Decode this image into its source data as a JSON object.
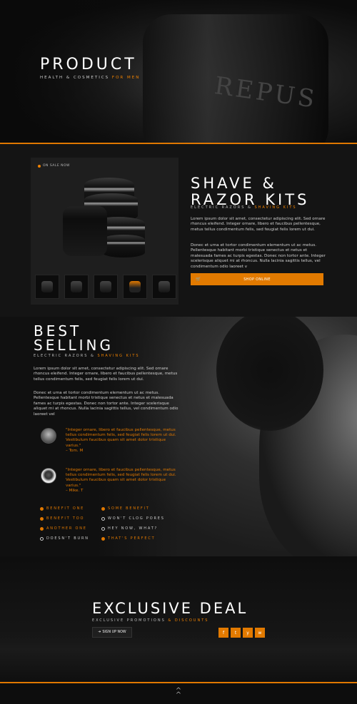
{
  "hero": {
    "title": "PRODUCT",
    "sub_prefix": "HEALTH & COSMETICS ",
    "sub_accent": "FOR MEN",
    "bg_text": "REPUS"
  },
  "product": {
    "sale_badge": "ON SALE NOW",
    "title_line1": "SHAVE &",
    "title_line2": "RAZOR KITS",
    "sub_prefix": "ELECTRIC RAZORS & ",
    "sub_accent": "SHAVING KITS",
    "p1": "Lorem ipsum dolor sit amet, consectetur adipiscing elit. Sed ornare rhoncus eleifend. Integer ornare, libero et faucibus pellentesque, metus tellus condimentum felis, sed feugiat felis lorem ut dui.",
    "p2": "Donec et urna et tortor condimentum elementum ut ac metus. Pellentesque habitant morbi tristique senectus et netus et malesuada fames ac turpis egestas. Donec non tortor ante. Integer scelerisque aliquet mi at rhoncus. Nulla lacinia sagittis tellus, vel condimentum odio laoreet v",
    "shop_label": "SHOP ONLINE"
  },
  "best": {
    "title_line1": "BEST",
    "title_line2": "SELLING",
    "sub_prefix": "ELECTRIC RAZORS & ",
    "sub_accent": "SHAVING KITS",
    "p1": "Lorem ipsum dolor sit amet, consectetur adipiscing elit. Sed ornare rhoncus eleifend. Integer ornare, libero et faucibus pellentesque, metus tellus condimentum felis, sed feugiat felis lorem ut dui.",
    "p2": "Donec et urna et tortor condimentum elementum ut ac metus. Pellentesque habitant morbi tristique senectus et netus et malesuada fames ac turpis egestas. Donec non tortor ante. Integer scelerisque aliquet mi at rhoncus. Nulla lacinia sagittis tellus, vel condimentum odio laoreet vel",
    "testimonials": [
      {
        "quote": "\"Integer ornare, libero et faucibus pellentesque, metus tellus condimentum felis, sed feugiat felis lorem ut dui. Vestibulum faucibus quam sit amet dolor tristique varius.\"",
        "author": "– Tom. M"
      },
      {
        "quote": "\"Integer ornare, libero et faucibus pellentesque, metus tellus condimentum felis, sed feugiat felis lorem ut dui. Vestibulum faucibus quam sit amet dolor tristique varius.\"",
        "author": "– Mike. T"
      }
    ],
    "features": [
      "BENEFIT ONE",
      "SOME BENEFIT",
      "BENEFIT TOO",
      "WON'T CLOG PORES",
      "ANOTHER ONE",
      "HEY NOW, WHAT?",
      "DOESN'T BURN",
      "THAT'S PERFECT"
    ]
  },
  "deal": {
    "title": "EXCLUSIVE DEAL",
    "sub_prefix": "EXCLUSIVE PROMOTIONS ",
    "sub_accent": "& DISCOUNTS",
    "signup_label": "SIGN UP NOW",
    "socials": [
      "f",
      "t",
      "y",
      "w"
    ]
  },
  "colors": {
    "accent": "#e27a00"
  }
}
